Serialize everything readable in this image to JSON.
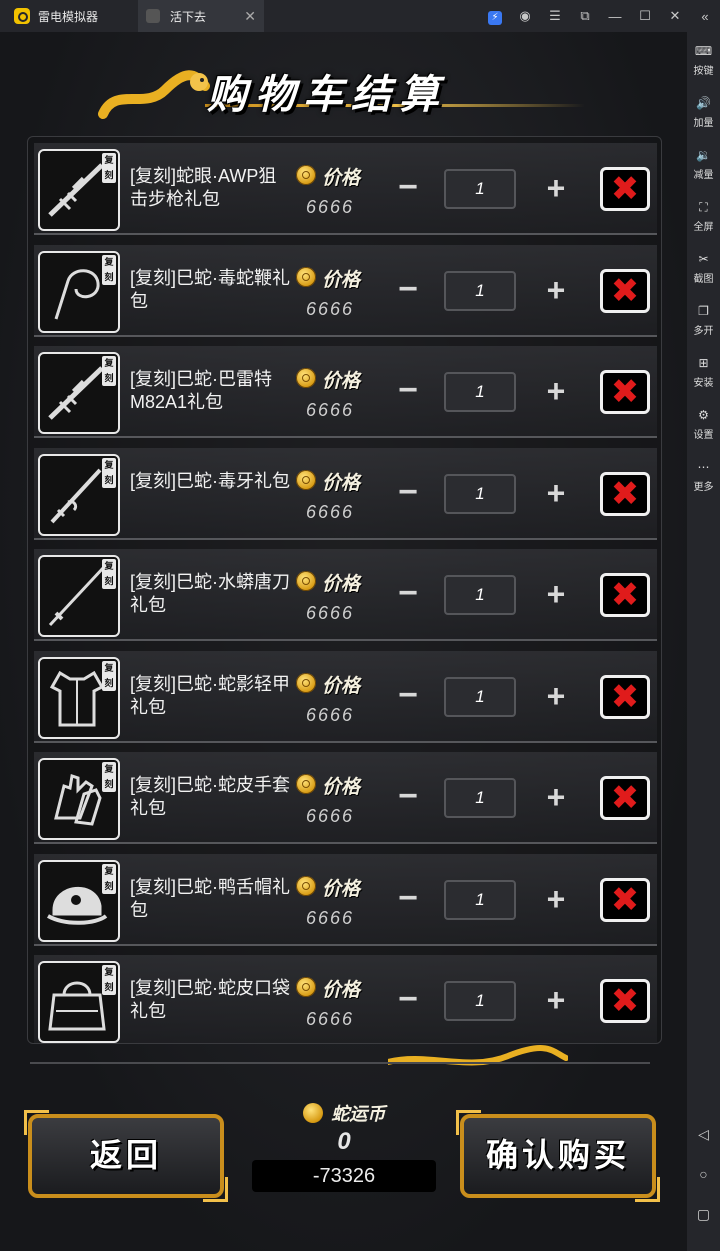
{
  "window": {
    "app_name": "雷电模拟器",
    "tab_title": "活下去",
    "tab_close": "✕",
    "controls": [
      "☰",
      "⧉",
      "—",
      "☐",
      "✕",
      "«"
    ]
  },
  "sidebar": {
    "items": [
      {
        "icon": "keyboard-icon",
        "glyph": "⌨",
        "label": "按键"
      },
      {
        "icon": "volume-up-icon",
        "glyph": "🔊",
        "label": "加量"
      },
      {
        "icon": "volume-down-icon",
        "glyph": "🔉",
        "label": "减量"
      },
      {
        "icon": "fullscreen-icon",
        "glyph": "⛶",
        "label": "全屏"
      },
      {
        "icon": "scissors-icon",
        "glyph": "✂",
        "label": "截图"
      },
      {
        "icon": "multi-instance-icon",
        "glyph": "❐",
        "label": "多开"
      },
      {
        "icon": "install-apk-icon",
        "glyph": "⊞",
        "label": "安装"
      },
      {
        "icon": "settings-icon",
        "glyph": "⚙",
        "label": "设置"
      },
      {
        "icon": "more-icon",
        "glyph": "⋯",
        "label": "更多"
      }
    ],
    "nav": {
      "back": "◁",
      "home": "○",
      "recent": "▢"
    }
  },
  "cart": {
    "title": "购物车结算",
    "price_label": "价格",
    "tag": "复刻",
    "minus": "−",
    "plus": "+",
    "delete": "✖",
    "items": [
      {
        "name": "[复刻]蛇眼·AWP狙击步枪礼包",
        "price": "6666",
        "qty": "1",
        "icon": "rifle"
      },
      {
        "name": "[复刻]巳蛇·毒蛇鞭礼包",
        "price": "6666",
        "qty": "1",
        "icon": "whip"
      },
      {
        "name": "[复刻]巳蛇·巴雷特M82A1礼包",
        "price": "6666",
        "qty": "1",
        "icon": "rifle"
      },
      {
        "name": "[复刻]巳蛇·毒牙礼包",
        "price": "6666",
        "qty": "1",
        "icon": "dagger"
      },
      {
        "name": "[复刻]巳蛇·水蟒唐刀礼包",
        "price": "6666",
        "qty": "1",
        "icon": "sword"
      },
      {
        "name": "[复刻]巳蛇·蛇影轻甲礼包",
        "price": "6666",
        "qty": "1",
        "icon": "armor"
      },
      {
        "name": "[复刻]巳蛇·蛇皮手套礼包",
        "price": "6666",
        "qty": "1",
        "icon": "gloves"
      },
      {
        "name": "[复刻]巳蛇·鸭舌帽礼包",
        "price": "6666",
        "qty": "1",
        "icon": "cap"
      },
      {
        "name": "[复刻]巳蛇·蛇皮口袋礼包",
        "price": "6666",
        "qty": "1",
        "icon": "bag"
      }
    ]
  },
  "footer": {
    "back_label": "返回",
    "confirm_label": "确认购买",
    "currency_label": "蛇运币",
    "currency_value": "0",
    "balance": "-73326"
  },
  "colors": {
    "accent_gold": "#c98e1c",
    "delete_red": "#e01b1b"
  }
}
